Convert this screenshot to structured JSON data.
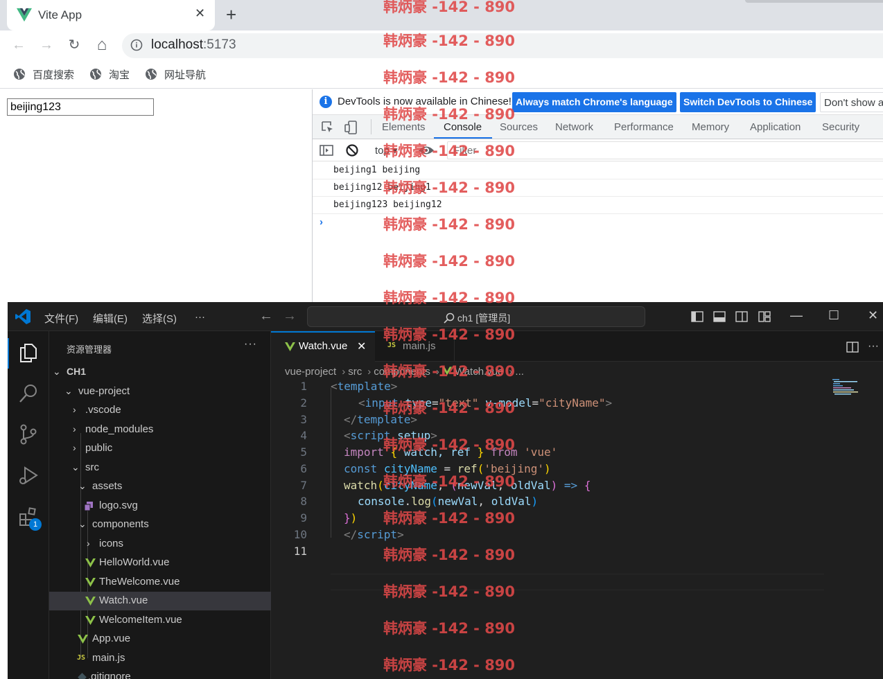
{
  "browser": {
    "tab_title": "Vite App",
    "tab_close": "✕",
    "new_tab": "+",
    "nav": {
      "back": "←",
      "forward": "→",
      "reload": "↻",
      "home": "⌂"
    },
    "url_host": "localhost",
    "url_port": ":5173",
    "bookmarks": [
      {
        "label": "百度搜索",
        "icon": "globe-icon"
      },
      {
        "label": "淘宝",
        "icon": "globe-icon"
      },
      {
        "label": "网址导航",
        "icon": "globe-icon"
      }
    ]
  },
  "page": {
    "city_input_value": "beijing123"
  },
  "devtools": {
    "info_text": "DevTools is now available in Chinese!",
    "btn_match_language": "Always match Chrome's language",
    "btn_switch_chinese": "Switch DevTools to Chinese",
    "btn_dont_show": "Don't show again",
    "tabs": [
      "Elements",
      "Console",
      "Sources",
      "Network",
      "Performance",
      "Memory",
      "Application",
      "Security"
    ],
    "active_tab": "Console",
    "context": "top ▾",
    "filter_placeholder": "Filter",
    "console_lines": [
      "beijing1 beijing",
      "beijing12 beijing1",
      "beijing123 beijing12"
    ],
    "prompt": "›"
  },
  "vscode": {
    "menu": [
      "文件(F)",
      "编辑(E)",
      "选择(S)",
      "···"
    ],
    "search_text": "ch1 [管理员]",
    "window_controls": {
      "minimize": "—",
      "maximize": "☐",
      "close": "✕"
    },
    "activity_badge": "1",
    "explorer_title": "资源管理器",
    "explorer_more": "···",
    "tree": [
      {
        "label": "CH1",
        "chev": "⌄",
        "kind": "root"
      },
      {
        "label": "vue-project",
        "chev": "⌄"
      },
      {
        "label": ".vscode",
        "chev": "›"
      },
      {
        "label": "node_modules",
        "chev": "›"
      },
      {
        "label": "public",
        "chev": "›"
      },
      {
        "label": "src",
        "chev": "⌄"
      },
      {
        "label": "assets",
        "chev": "⌄"
      },
      {
        "label": "logo.svg",
        "icon": "svg-file-icon"
      },
      {
        "label": "components",
        "chev": "⌄"
      },
      {
        "label": "icons",
        "chev": "›"
      },
      {
        "label": "HelloWorld.vue",
        "icon": "vue-file-icon"
      },
      {
        "label": "TheWelcome.vue",
        "icon": "vue-file-icon"
      },
      {
        "label": "Watch.vue",
        "icon": "vue-file-icon",
        "selected": true
      },
      {
        "label": "WelcomeItem.vue",
        "icon": "vue-file-icon"
      },
      {
        "label": "App.vue",
        "icon": "vue-file-icon"
      },
      {
        "label": "main.js",
        "icon": "js-file-icon"
      },
      {
        "label": ".gitignore",
        "icon": "git-file-icon"
      }
    ],
    "editor_tabs": [
      {
        "label": "Watch.vue",
        "icon": "vue-file-icon",
        "active": true,
        "close": "✕"
      },
      {
        "label": "main.js",
        "icon": "js-file-icon",
        "active": false
      }
    ],
    "js_badge": "JS",
    "breadcrumb": [
      "vue-project",
      "src",
      "components",
      "Watch.vue",
      "..."
    ],
    "line_numbers": [
      "1",
      "2",
      "3",
      "4",
      "5",
      "6",
      "7",
      "8",
      "9",
      "10",
      "11"
    ],
    "current_line": "11",
    "code": {
      "l1": {
        "a": "<",
        "b": "template",
        "c": ">"
      },
      "l2": {
        "a": "<",
        "b": "input",
        "c": " ",
        "d": "type",
        "e": "=",
        "f": "\"text\"",
        "g": " ",
        "h": "v-model",
        "i": "=",
        "j": "\"cityName\"",
        "k": ">"
      },
      "l3": {
        "a": "</",
        "b": "template",
        "c": ">"
      },
      "l4": {
        "a": "<",
        "b": "script",
        "c": " ",
        "d": "setup",
        "e": ">"
      },
      "l5": {
        "a": "import",
        "b": " ",
        "c": "{",
        "d": " watch, ref ",
        "e": "}",
        "f": " ",
        "g": "from",
        "h": " ",
        "i": "'vue'"
      },
      "l6": {
        "a": "const",
        "b": " ",
        "c": "cityName",
        "d": " = ",
        "e": "ref",
        "f": "(",
        "g": "'beijing'",
        "h": ")"
      },
      "l7": {
        "a": "watch",
        "b": "(",
        "c": "cityName",
        "d": ", ",
        "e": "(",
        "f": "newVal",
        "g": ", ",
        "h": "oldVal",
        "i": ")",
        "j": " => ",
        "k": "{"
      },
      "l8": {
        "a": "console",
        "b": ".",
        "c": "log",
        "d": "(",
        "e": "newVal",
        "f": ", ",
        "g": "oldVal",
        "h": ")"
      },
      "l9": {
        "a": "}",
        "b": ")"
      },
      "l10": {
        "a": "</",
        "b": "script",
        "c": ">"
      }
    }
  },
  "watermark": "韩炳豪 -142 - 890"
}
